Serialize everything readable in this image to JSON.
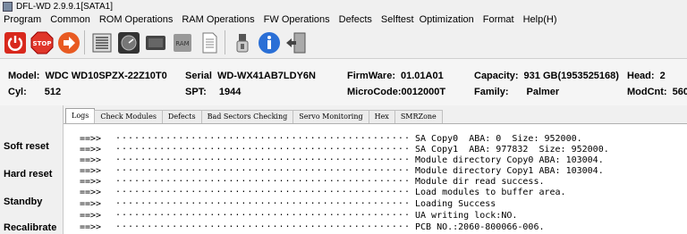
{
  "title": "DFL-WD 2.9.9.1[SATA1]",
  "menu": [
    "Program",
    "Common",
    "ROM Operations",
    "RAM Operations",
    "FW Operations",
    "Defects",
    "Selftest",
    "Optimization",
    "Format",
    "Help(H)"
  ],
  "toolbar_icons": [
    "power-icon",
    "stop-icon",
    "arrow-right-icon",
    "memory-chip-icon",
    "gauge-icon",
    "chip-dark-icon",
    "ram-icon",
    "document-icon",
    "usb-plug-icon",
    "info-icon",
    "exit-door-icon"
  ],
  "drive": {
    "model_label": "Model:",
    "model": "WDC WD10SPZX-22Z10T0",
    "cyl_label": "Cyl:",
    "cyl": "512",
    "serial_label": "Serial",
    "serial": "WD-WX41AB7LDY6N",
    "spt_label": "SPT:",
    "spt": "1944",
    "firmware_label": "FirmWare:",
    "firmware": "01.01A01",
    "microcode_label": "MicroCode:",
    "microcode": "0012000T",
    "capacity_label": "Capacity:",
    "capacity": "931 GB(1953525168)",
    "family_label": "Family:",
    "family": "Palmer",
    "head_label": "Head:",
    "head": "2",
    "modcnt_label": "ModCnt:",
    "modcnt": "560"
  },
  "left_buttons": [
    "Soft reset",
    "Hard reset",
    "Standby",
    "Recalibrate"
  ],
  "tabs": [
    "Logs",
    "Check Modules",
    "Defects",
    "Bad Sectors Checking",
    "Servo Monitoring",
    "Hex",
    "SMRZone"
  ],
  "active_tab": "Logs",
  "log": [
    {
      "arrow": "==>>",
      "dots": "...............................................",
      "msg": "SA Copy0  ABA: 0  Size: 952000."
    },
    {
      "arrow": "==>>",
      "dots": "...............................................",
      "msg": "SA Copy1  ABA: 977832  Size: 952000."
    },
    {
      "arrow": "==>>",
      "dots": "...............................................",
      "msg": "Module directory Copy0 ABA: 103004."
    },
    {
      "arrow": "==>>",
      "dots": "...............................................",
      "msg": "Module directory Copy1 ABA: 103004."
    },
    {
      "arrow": "==>>",
      "dots": "...............................................",
      "msg": "Module dir read success."
    },
    {
      "arrow": "==>>",
      "dots": "...............................................",
      "msg": "Load modules to buffer area."
    },
    {
      "arrow": "==>>",
      "dots": "...............................................",
      "msg": "Loading Success"
    },
    {
      "arrow": "==>>",
      "dots": "...............................................",
      "msg": "UA writing lock:NO."
    },
    {
      "arrow": "==>>",
      "dots": "...............................................",
      "msg": "PCB NO.:2060-800066-006."
    }
  ]
}
